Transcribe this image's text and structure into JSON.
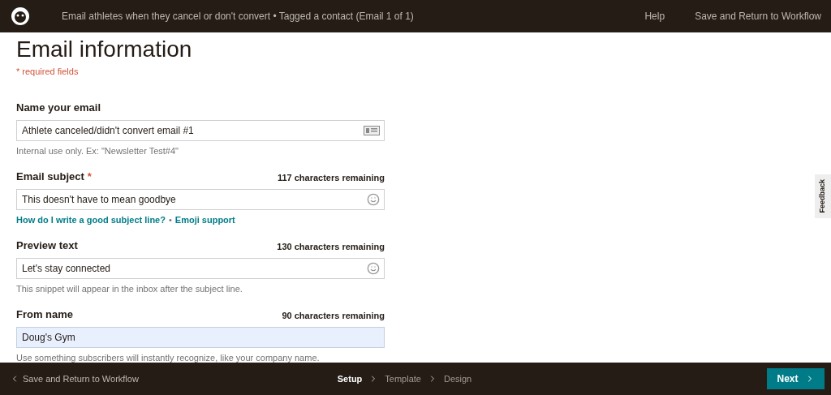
{
  "header": {
    "title": "Email athletes when they cancel or don't convert • Tagged a contact (Email 1 of 1)",
    "links": [
      "Help",
      "Save and Return to Workflow"
    ]
  },
  "page": {
    "title": "Email information",
    "required_note": "* required fields"
  },
  "fields": [
    {
      "kind": "card",
      "label": "Name your email",
      "value": "Athlete canceled/didn't convert email #1",
      "autofilled": false,
      "hint": "Internal use only. Ex: \"Newsletter Test#4\""
    },
    {
      "kind": "emoji",
      "label": "Email subject",
      "required_mark": "*",
      "counter": "117 characters remaining",
      "value": "This doesn't have to mean goodbye",
      "autofilled": false,
      "links": [
        "How do I write a good subject line?",
        "Emoji support"
      ],
      "link_separator": "•"
    },
    {
      "kind": "emoji",
      "label": "Preview text",
      "counter": "130 characters remaining",
      "value": "Let's stay connected",
      "autofilled": false,
      "hint": "This snippet will appear in the inbox after the subject line."
    },
    {
      "kind": "plain",
      "label": "From name",
      "counter": "90 characters remaining",
      "value": "Doug's Gym",
      "autofilled": true,
      "hint": "Use something subscribers will instantly recognize, like your company name."
    }
  ],
  "feedback_tab": "Feedback",
  "footer": {
    "back": "Save and Return to Workflow",
    "steps": [
      {
        "label": "Setup",
        "selected": true
      },
      {
        "label": "Template",
        "selected": false
      },
      {
        "label": "Design",
        "selected": false
      }
    ],
    "next": "Next"
  }
}
